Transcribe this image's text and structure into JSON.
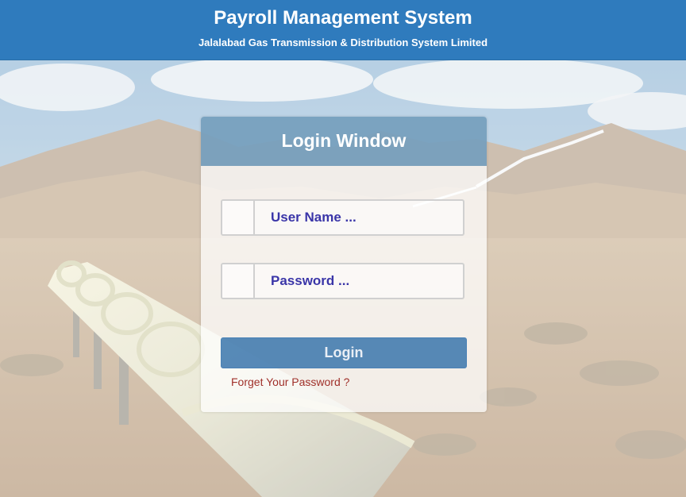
{
  "header": {
    "title": "Payroll Management System",
    "subtitle": "Jalalabad Gas Transmission & Distribution System Limited",
    "background_color": "#2f7bbd"
  },
  "login": {
    "title": "Login Window",
    "username_placeholder": "User Name ...",
    "password_placeholder": "Password ...",
    "button_label": "Login",
    "forgot_link": "Forget Your Password ?",
    "accent_color": "#3a75ac",
    "field_text_color": "#3a35a8",
    "link_color": "#a0302a"
  },
  "background": {
    "icon": "pipeline-desert-photo"
  }
}
